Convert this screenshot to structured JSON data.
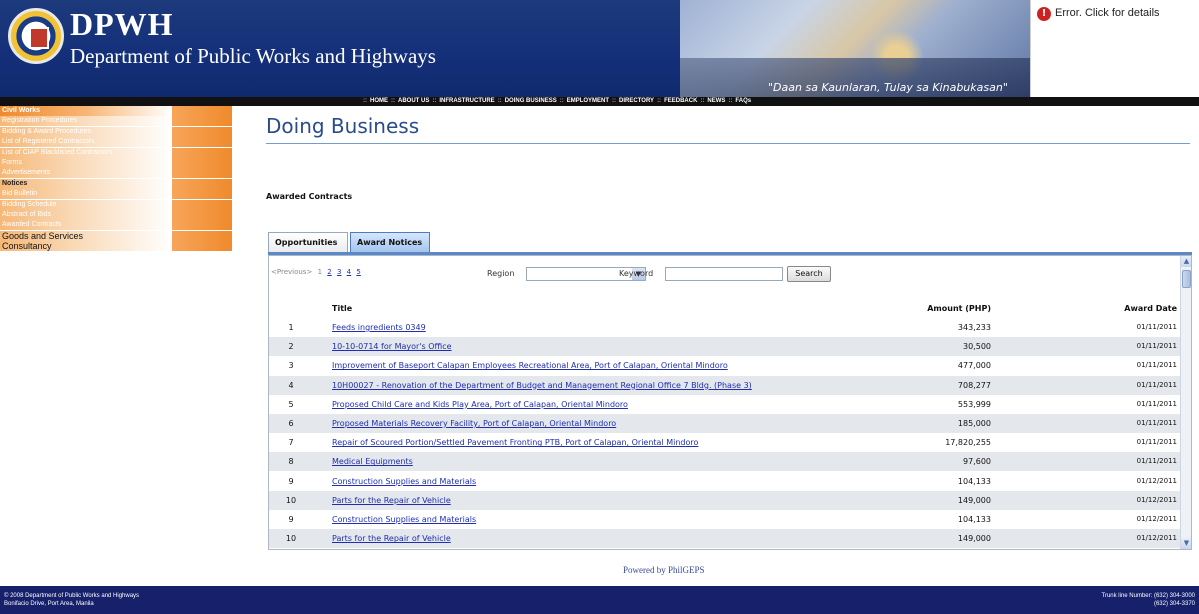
{
  "header": {
    "brand_title": "DPWH",
    "brand_sub": "Department of Public Works and Highways",
    "banner_quote": "\"Daan sa Kaunlaran, Tulay sa Kinabukasan\"",
    "error_text": "Error.  Click for details"
  },
  "nav": {
    "links": [
      "HOME",
      "ABOUT US",
      "INFRASTRUCTURE",
      "DOING BUSINESS",
      "EMPLOYMENT",
      "DIRECTORY",
      "FEEDBACK",
      "NEWS",
      "FAQs"
    ],
    "separator": "::"
  },
  "sidebar": {
    "items": [
      {
        "label": "Civil Works",
        "style": "head"
      },
      {
        "label": "Registration Procedures",
        "style": "sub"
      },
      {
        "label": "Bidding & Award Procedures",
        "style": "sub"
      },
      {
        "label": "List of Registered Contractors",
        "style": "sub"
      },
      {
        "label": "List of CIAP Blacklisted Contractors",
        "style": "sub"
      },
      {
        "label": "Forms",
        "style": "sub"
      },
      {
        "label": "Advertisements",
        "style": "sub"
      },
      {
        "label": "Notices",
        "style": "bold"
      },
      {
        "label": "Bid Bulletin",
        "style": "sub"
      },
      {
        "label": "Bidding Schedule",
        "style": "sub"
      },
      {
        "label": "Abstract of Bids",
        "style": "sub"
      },
      {
        "label": "Awarded Contracts",
        "style": "sub"
      },
      {
        "label": "Goods and Services",
        "style": "main"
      },
      {
        "label": "Consultancy",
        "style": "main"
      }
    ]
  },
  "main": {
    "page_title": "Doing Business",
    "section_label": "Awarded Contracts",
    "tabs": [
      {
        "label": "Opportunities",
        "active": false
      },
      {
        "label": "Award Notices",
        "active": true
      }
    ],
    "pager": {
      "previous": "<Previous>",
      "current": "1",
      "pages": [
        "2",
        "3",
        "4",
        "5"
      ]
    },
    "filters": {
      "region_label": "Region",
      "region_value": "",
      "keyword_label": "Keyword",
      "keyword_value": "",
      "search_label": "Search"
    },
    "table": {
      "columns": [
        "Title",
        "Amount (PHP)",
        "Award Date"
      ],
      "rows": [
        {
          "num": "1",
          "title": "Feeds ingredients 0349",
          "amount": "343,233",
          "date": "01/11/2011"
        },
        {
          "num": "2",
          "title": "10-10-0714 for Mayor's Office",
          "amount": "30,500",
          "date": "01/11/2011"
        },
        {
          "num": "3",
          "title": "Improvement of Baseport Calapan Employees Recreational Area, Port of Calapan, Oriental Mindoro",
          "amount": "477,000",
          "date": "01/11/2011"
        },
        {
          "num": "4",
          "title": "10H00027 - Renovation of the Department of Budget and Management Regional Office 7 Bldg. (Phase 3)",
          "amount": "708,277",
          "date": "01/11/2011"
        },
        {
          "num": "5",
          "title": "Proposed Child Care and Kids Play Area, Port of Calapan, Oriental Mindoro",
          "amount": "553,999",
          "date": "01/11/2011"
        },
        {
          "num": "6",
          "title": "Proposed Materials Recovery Facility, Port of Calapan, Oriental Mindoro",
          "amount": "185,000",
          "date": "01/11/2011"
        },
        {
          "num": "7",
          "title": "Repair of Scoured Portion/Settled Pavement Fronting PTB, Port of Calapan, Oriental Mindoro",
          "amount": "17,820,255",
          "date": "01/11/2011"
        },
        {
          "num": "8",
          "title": "Medical Equipments",
          "amount": "97,600",
          "date": "01/11/2011"
        },
        {
          "num": "9",
          "title": "Construction Supplies and Materials",
          "amount": "104,133",
          "date": "01/12/2011"
        },
        {
          "num": "10",
          "title": "Parts for the Repair of Vehicle",
          "amount": "149,000",
          "date": "01/12/2011"
        },
        {
          "num": "9",
          "title": "Construction Supplies and Materials",
          "amount": "104,133",
          "date": "01/12/2011"
        },
        {
          "num": "10",
          "title": "Parts for the Repair of Vehicle",
          "amount": "149,000",
          "date": "01/12/2011"
        }
      ]
    },
    "powered_by": "Powered by PhilGEPS"
  },
  "footer": {
    "left_line1": "© 2008 Department of Public Works and Highways",
    "left_line2": "Bonifacio Drive, Port Area, Manila",
    "right_line1": "Trunk line Number: (632) 304-3000",
    "right_line2": "(632) 304-3370"
  },
  "colors": {
    "header_blue": "#14307a",
    "nav_black": "#111111",
    "sidebar_orange": "#f08a2c",
    "link_blue": "#1f2fb0",
    "tab_active": "#9dc1ee",
    "footer_navy": "#17206b"
  }
}
